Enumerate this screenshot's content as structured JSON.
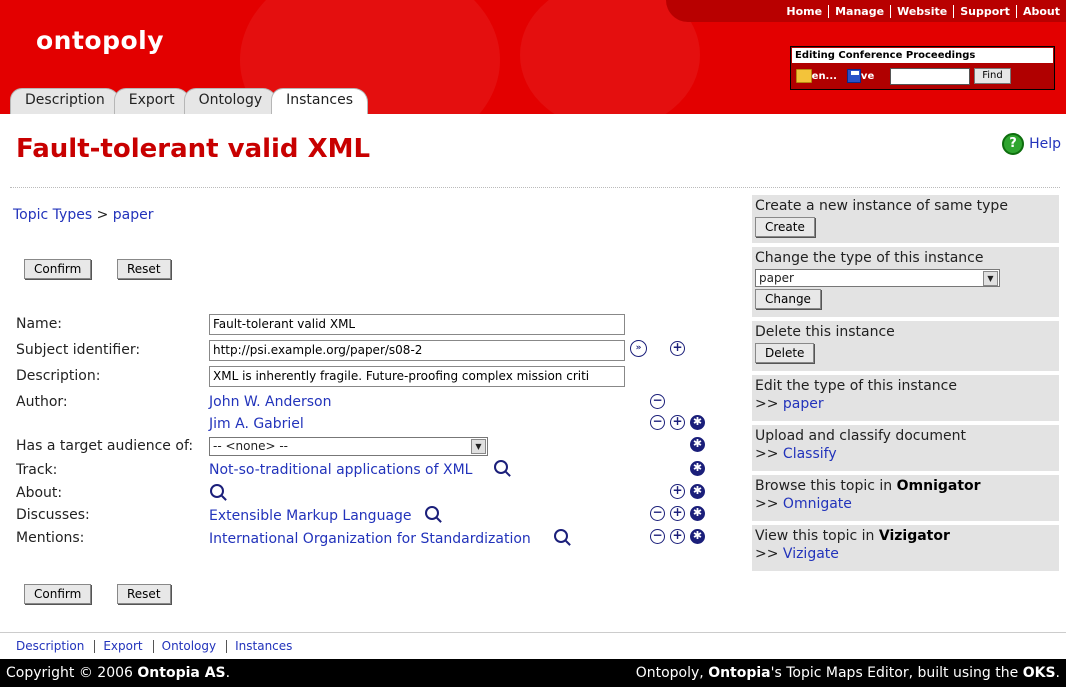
{
  "topnav": [
    "Home",
    "Manage",
    "Website",
    "Support",
    "About"
  ],
  "logo": "ontopoly",
  "edit_box": {
    "title": "Editing Conference Proceedings",
    "open_label": "Open...",
    "save_label": "Save",
    "search_value": "",
    "find_label": "Find"
  },
  "tabs": [
    "Description",
    "Export",
    "Ontology",
    "Instances"
  ],
  "active_tab": "Instances",
  "page_title": "Fault-tolerant valid XML",
  "help_label": "Help",
  "breadcrumb": {
    "root": "Topic Types",
    "sep": ">",
    "current": "paper"
  },
  "buttons": {
    "confirm": "Confirm",
    "reset": "Reset"
  },
  "form": {
    "name_label": "Name:",
    "name_value": "Fault-tolerant valid XML",
    "subject_label": "Subject identifier:",
    "subject_value": "http://psi.example.org/paper/s08-2",
    "description_label": "Description:",
    "description_value": "XML is inherently fragile. Future-proofing complex mission criti",
    "author_label": "Author:",
    "authors": [
      "John W. Anderson",
      "Jim A. Gabriel"
    ],
    "audience_label": "Has a target audience of:",
    "audience_value": "-- <none> --",
    "track_label": "Track:",
    "track_value": "Not-so-traditional applications of XML",
    "about_label": "About:",
    "discusses_label": "Discusses:",
    "discusses_value": "Extensible Markup Language",
    "mentions_label": "Mentions:",
    "mentions_value": "International Organization for Standardization"
  },
  "sidebar": {
    "create_text": "Create a new instance of same type",
    "create_btn": "Create",
    "change_text": "Change the type of this instance",
    "change_select": "paper",
    "change_btn": "Change",
    "delete_text": "Delete this instance",
    "delete_btn": "Delete",
    "edit_text": "Edit the type of this instance",
    "edit_link": "paper",
    "upload_text": "Upload and classify document",
    "upload_link": "Classify",
    "browse_text": "Browse this topic in",
    "browse_bold": "Omnigator",
    "browse_link": "Omnigate",
    "view_text": "View this topic in",
    "view_bold": "Vizigator",
    "view_link": "Vizigate",
    "prefix": ">>"
  },
  "footer_nav": [
    "Description",
    "Export",
    "Ontology",
    "Instances"
  ],
  "footer": {
    "copyright": "Copyright © 2006",
    "company": "Ontopia AS",
    "right_a": "Ontopoly,",
    "right_b": "Ontopia",
    "right_c": "'s Topic Maps Editor, built using the",
    "right_d": "OKS",
    "period": "."
  },
  "colors": {
    "brand_red": "#e30000",
    "title_red": "#c80000",
    "link": "#2233bb"
  }
}
